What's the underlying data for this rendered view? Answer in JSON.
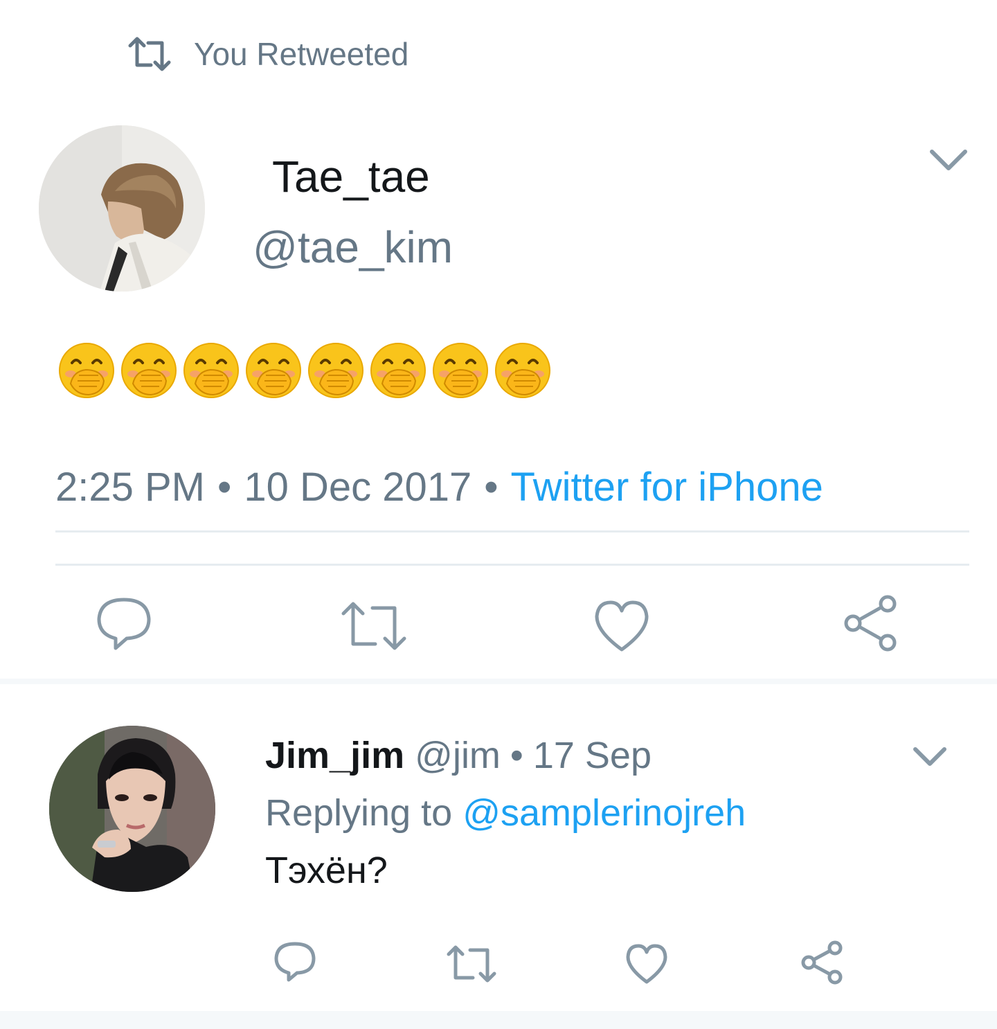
{
  "retweet_context": {
    "label": "You Retweeted",
    "icon": "retweet-icon"
  },
  "main_tweet": {
    "display_name": "Tae_tae",
    "handle": "@tae_kim",
    "content_emoji_count": 8,
    "content_emoji": "hand-over-mouth-emoji",
    "time": "2:25 PM",
    "date": "10 Dec 2017",
    "separator": "•",
    "source": "Twitter for iPhone"
  },
  "reply_tweet": {
    "display_name": "Jim_jim",
    "handle": "@jim",
    "separator": "•",
    "date": "17 Sep",
    "replying_prefix": "Replying to",
    "replying_mention": "@samplerinojreh",
    "text": "Тэхён?"
  },
  "actions": [
    "reply-icon",
    "retweet-icon",
    "like-icon",
    "share-icon"
  ],
  "colors": {
    "accent": "#1da1f2",
    "secondary_text": "#657786",
    "primary_text": "#14171a",
    "icon": "#8899a6",
    "divider": "#e6ecf0",
    "background": "#f5f8fa"
  }
}
